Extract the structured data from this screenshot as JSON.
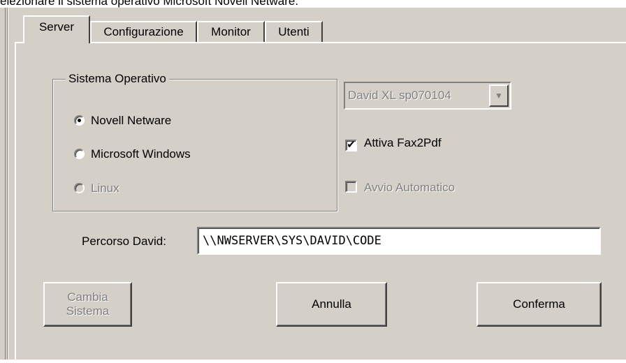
{
  "caption": "elezionare il sistema operativo Microsoft Novell Netware.",
  "tabs": [
    {
      "label": "Server"
    },
    {
      "label": "Configurazione"
    },
    {
      "label": "Monitor"
    },
    {
      "label": "Utenti"
    }
  ],
  "group": {
    "title": "Sistema Operativo",
    "options": [
      {
        "label": "Novell Netware",
        "selected": true,
        "enabled": true
      },
      {
        "label": "Microsoft Windows",
        "selected": false,
        "enabled": true
      },
      {
        "label": "Linux",
        "selected": false,
        "enabled": false
      }
    ]
  },
  "combo": {
    "value": "David XL sp070104",
    "arrow_icon": "chevron-down-icon"
  },
  "checks": {
    "fax2pdf": {
      "label": "Attiva Fax2Pdf",
      "checked": true,
      "enabled": true,
      "mark": "✔"
    },
    "autostart": {
      "label": "Avvio Automatico",
      "checked": false,
      "enabled": false
    }
  },
  "path": {
    "label": "Percorso David:",
    "value": "\\\\NWSERVER\\SYS\\DAVID\\CODE"
  },
  "buttons": {
    "change_system": "Cambia\nSistema",
    "cancel": "Annulla",
    "confirm": "Conferma"
  }
}
